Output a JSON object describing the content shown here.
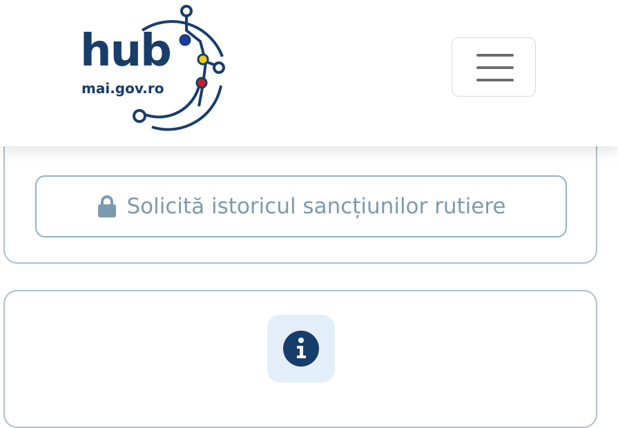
{
  "header": {
    "logo": {
      "wordmark": "hub",
      "subtitle": "mai.gov.ro",
      "icon": "circuit-logo"
    },
    "menu_button": {
      "icon": "hamburger-menu-icon"
    }
  },
  "request_card": {
    "button_label": "Solicită istoricul sancțiunilor rutiere",
    "icon": "lock-icon"
  },
  "info_card": {
    "icon": "info-icon"
  },
  "colors": {
    "brand_navy": "#173d6b",
    "border_blue": "#a9bfd0",
    "muted_text": "#7b9ab0",
    "info_bg": "#e4eef8",
    "flag_blue": "#1f3aa8",
    "flag_yellow": "#f2cc1a",
    "flag_red": "#c81d25"
  }
}
